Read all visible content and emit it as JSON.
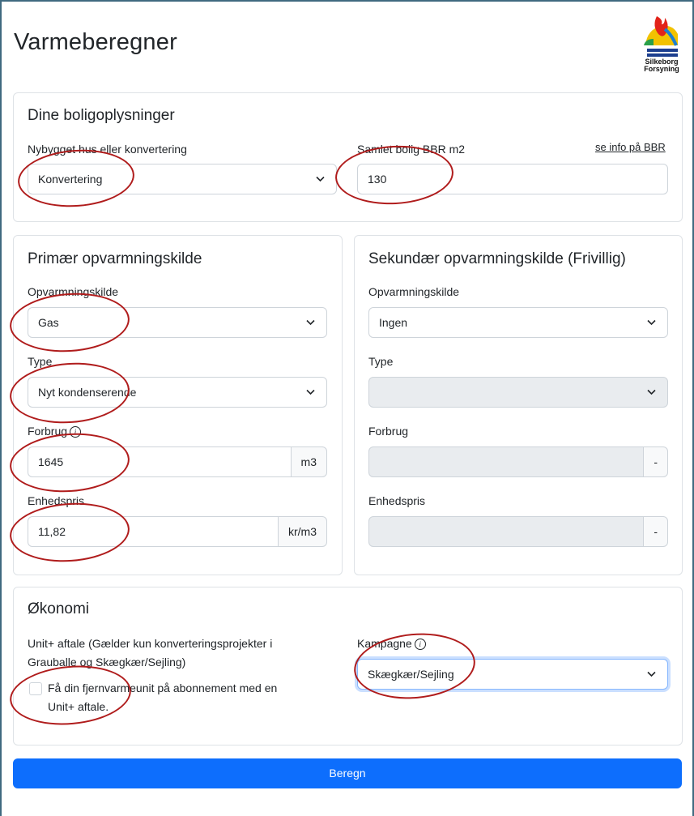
{
  "page": {
    "title": "Varmeberegner",
    "logo_text_1": "Silkeborg",
    "logo_text_2": "Forsyning"
  },
  "housing": {
    "heading": "Dine boligoplysninger",
    "type_label": "Nybygget hus eller konvertering",
    "type_value": "Konvertering",
    "area_label": "Samlet bolig BBR m2",
    "area_link": "se info på BBR",
    "area_value": "130"
  },
  "primary": {
    "heading": "Primær opvarmningskilde",
    "source_label": "Opvarmningskilde",
    "source_value": "Gas",
    "type_label": "Type",
    "type_value": "Nyt kondenserende",
    "usage_label": "Forbrug",
    "usage_value": "1645",
    "usage_unit": "m3",
    "price_label": "Enhedspris",
    "price_value": "11,82",
    "price_unit": "kr/m3"
  },
  "secondary": {
    "heading": "Sekundær opvarmningskilde (Frivillig)",
    "source_label": "Opvarmningskilde",
    "source_value": "Ingen",
    "type_label": "Type",
    "usage_label": "Forbrug",
    "usage_unit": "-",
    "price_label": "Enhedspris",
    "price_unit": "-"
  },
  "economy": {
    "heading": "Økonomi",
    "unit_label_line1": "Unit+ aftale (Gælder kun konverteringsprojekter i",
    "unit_label_line2": "Grauballe og Skægkær/Sejling)",
    "checkbox_line1": "Få din fjernvarmeunit på abonnement med en",
    "checkbox_line2": "Unit+ aftale.",
    "campaign_label": "Kampagne",
    "campaign_value": "Skægkær/Sejling"
  },
  "submit_label": "Beregn",
  "colors": {
    "primary": "#0d6efd",
    "annotation": "#b01c1c",
    "frame": "#3f6a80"
  }
}
